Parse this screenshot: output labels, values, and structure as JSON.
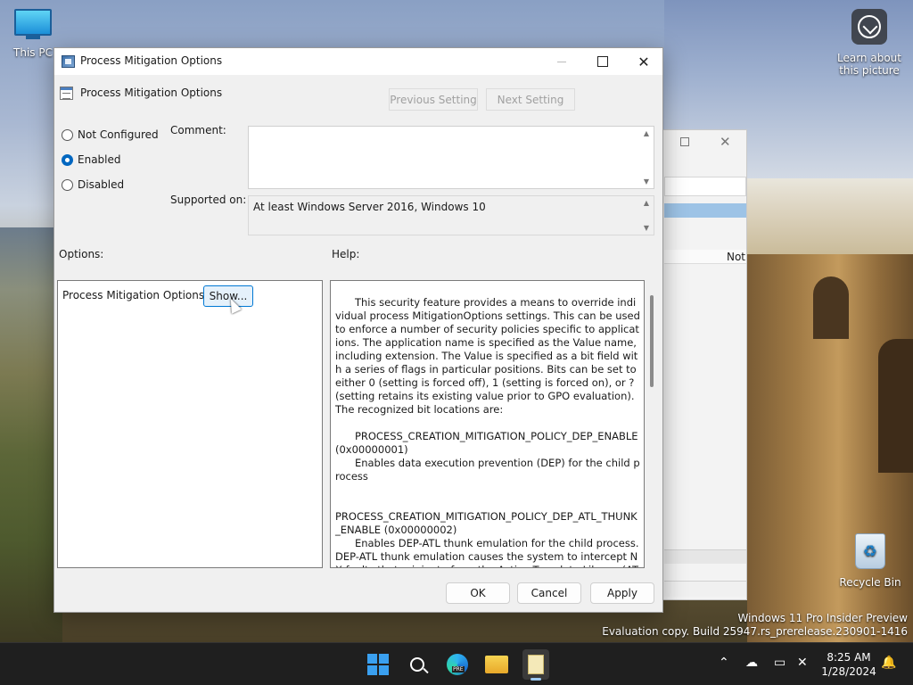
{
  "desktop": {
    "this_pc_label": "This PC",
    "learn_label": "Learn about this picture",
    "recycle_label": "Recycle Bin",
    "watermark_line1": "Windows 11 Pro Insider Preview",
    "watermark_line2": "Evaluation copy. Build 25947.rs_prerelease.230901-1416"
  },
  "background_window": {
    "column_header": "Not"
  },
  "dialog": {
    "window_title": "Process Mitigation Options",
    "policy_name": "Process Mitigation Options",
    "prev_label": "Previous Setting",
    "next_label": "Next Setting",
    "states": {
      "not_configured": "Not Configured",
      "enabled": "Enabled",
      "disabled": "Disabled",
      "selected": "enabled"
    },
    "comment_label": "Comment:",
    "comment_value": "",
    "supported_label": "Supported on:",
    "supported_value": "At least Windows Server 2016, Windows 10",
    "options_label": "Options:",
    "help_label": "Help:",
    "option_item_label": "Process Mitigation Options",
    "show_label": "Show...",
    "help_text": "      This security feature provides a means to override individual process MitigationOptions settings. This can be used to enforce a number of security policies specific to applications. The application name is specified as the Value name, including extension. The Value is specified as a bit field with a series of flags in particular positions. Bits can be set to either 0 (setting is forced off), 1 (setting is forced on), or ? (setting retains its existing value prior to GPO evaluation). The recognized bit locations are:\n\n      PROCESS_CREATION_MITIGATION_POLICY_DEP_ENABLE (0x00000001)\n      Enables data execution prevention (DEP) for the child process\n\n\nPROCESS_CREATION_MITIGATION_POLICY_DEP_ATL_THUNK_ENABLE (0x00000002)\n      Enables DEP-ATL thunk emulation for the child process. DEP-ATL thunk emulation causes the system to intercept NX faults that originate from the Active Template Library (ATL) thunk layer.",
    "ok_label": "OK",
    "cancel_label": "Cancel",
    "apply_label": "Apply"
  },
  "taskbar": {
    "time": "8:25 AM",
    "date": "1/28/2024"
  },
  "icons": {
    "app": "policy-editor-icon",
    "start": "windows-start-icon",
    "search": "search-icon",
    "edge": "edge-beta-icon",
    "explorer": "file-explorer-icon",
    "notepad": "notepad-icon"
  }
}
